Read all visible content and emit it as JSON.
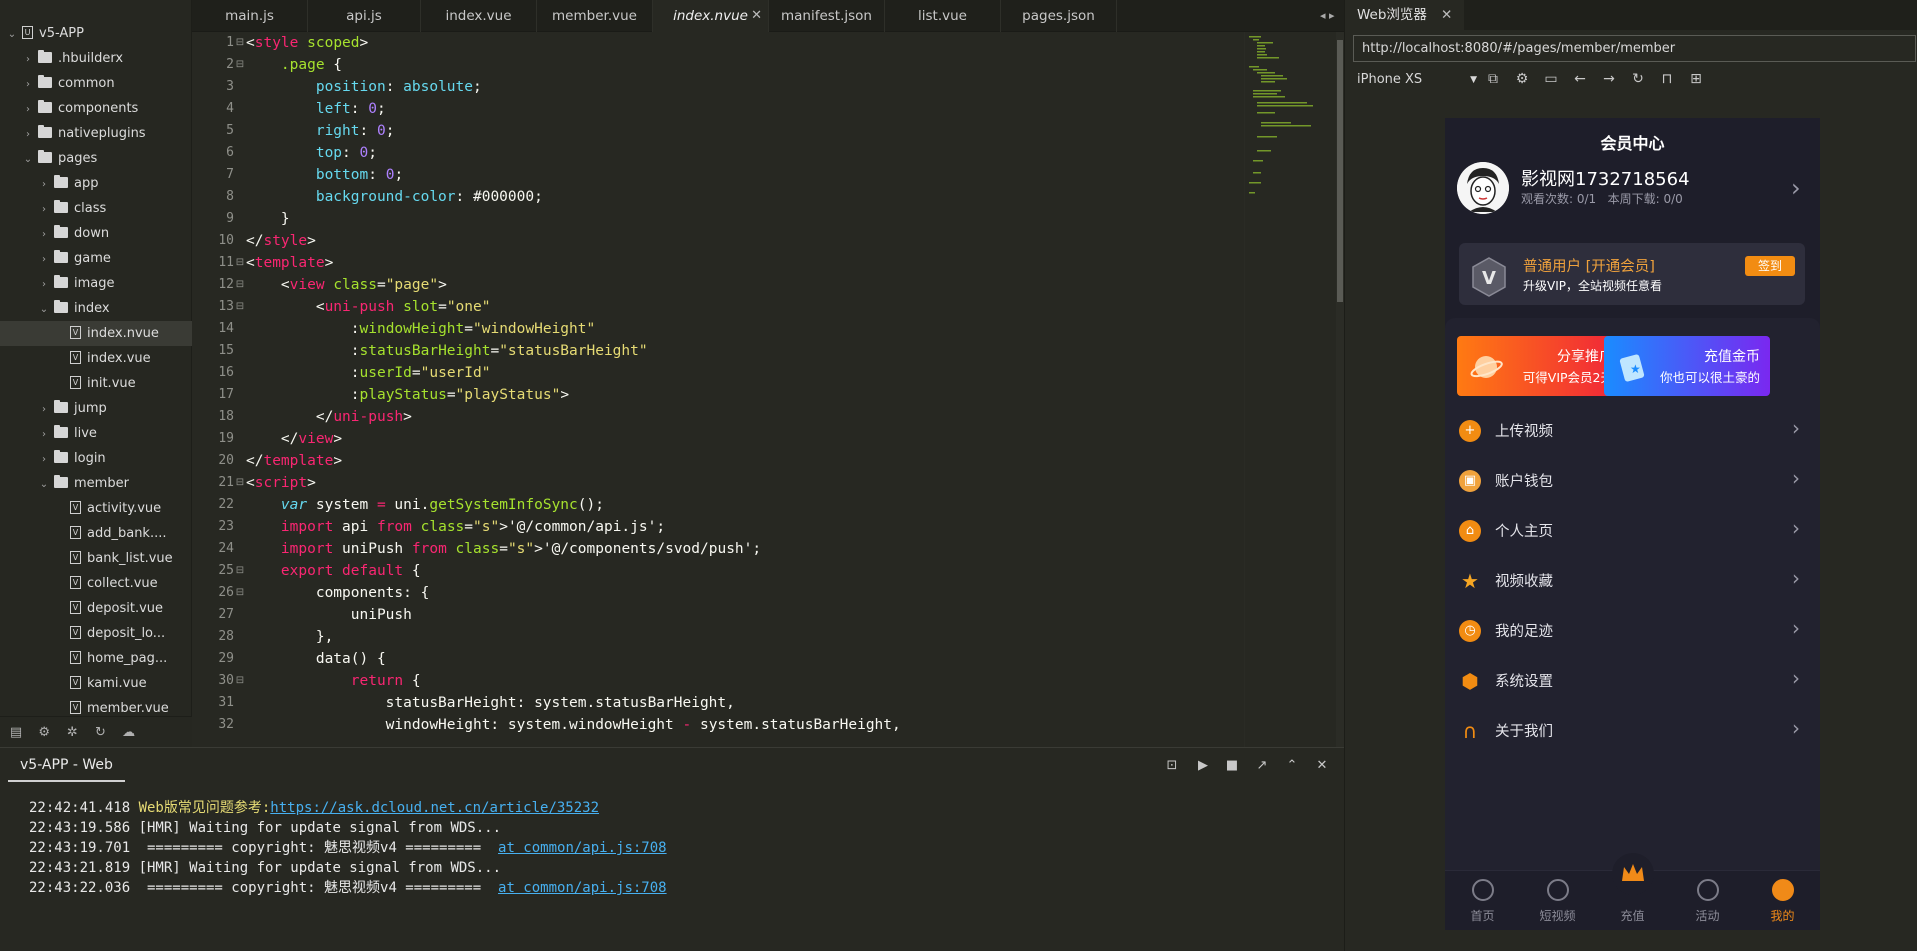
{
  "project": {
    "name": "v5-APP"
  },
  "tree": [
    {
      "label": "v5-APP",
      "kind": "project",
      "depth": 0,
      "open": true
    },
    {
      "label": ".hbuilderx",
      "kind": "folder",
      "depth": 1,
      "open": false
    },
    {
      "label": "common",
      "kind": "folder",
      "depth": 1,
      "open": false
    },
    {
      "label": "components",
      "kind": "folder",
      "depth": 1,
      "open": false
    },
    {
      "label": "nativeplugins",
      "kind": "folder",
      "depth": 1,
      "open": false
    },
    {
      "label": "pages",
      "kind": "folder",
      "depth": 1,
      "open": true
    },
    {
      "label": "app",
      "kind": "folder",
      "depth": 2,
      "open": false
    },
    {
      "label": "class",
      "kind": "folder",
      "depth": 2,
      "open": false
    },
    {
      "label": "down",
      "kind": "folder",
      "depth": 2,
      "open": false
    },
    {
      "label": "game",
      "kind": "folder",
      "depth": 2,
      "open": false
    },
    {
      "label": "image",
      "kind": "folder",
      "depth": 2,
      "open": false
    },
    {
      "label": "index",
      "kind": "folder",
      "depth": 2,
      "open": true
    },
    {
      "label": "index.nvue",
      "kind": "file",
      "depth": 3,
      "selected": true
    },
    {
      "label": "index.vue",
      "kind": "file",
      "depth": 3
    },
    {
      "label": "init.vue",
      "kind": "file",
      "depth": 3
    },
    {
      "label": "jump",
      "kind": "folder",
      "depth": 2,
      "open": false
    },
    {
      "label": "live",
      "kind": "folder",
      "depth": 2,
      "open": false
    },
    {
      "label": "login",
      "kind": "folder",
      "depth": 2,
      "open": false
    },
    {
      "label": "member",
      "kind": "folder",
      "depth": 2,
      "open": true
    },
    {
      "label": "activity.vue",
      "kind": "file",
      "depth": 3
    },
    {
      "label": "add_bank....",
      "kind": "file",
      "depth": 3
    },
    {
      "label": "bank_list.vue",
      "kind": "file",
      "depth": 3
    },
    {
      "label": "collect.vue",
      "kind": "file",
      "depth": 3
    },
    {
      "label": "deposit.vue",
      "kind": "file",
      "depth": 3
    },
    {
      "label": "deposit_lo...",
      "kind": "file",
      "depth": 3
    },
    {
      "label": "home_pag...",
      "kind": "file",
      "depth": 3
    },
    {
      "label": "kami.vue",
      "kind": "file",
      "depth": 3
    },
    {
      "label": "member.vue",
      "kind": "file",
      "depth": 3
    }
  ],
  "tabs": [
    {
      "label": "main.js",
      "active": false
    },
    {
      "label": "api.js",
      "active": false
    },
    {
      "label": "index.vue",
      "active": false
    },
    {
      "label": "member.vue",
      "active": false
    },
    {
      "label": "index.nvue",
      "active": true
    },
    {
      "label": "manifest.json",
      "active": false
    },
    {
      "label": "list.vue",
      "active": false
    },
    {
      "label": "pages.json",
      "active": false
    }
  ],
  "code": [
    "<style scoped>",
    "    .page {",
    "        position: absolute;",
    "        left: 0;",
    "        right: 0;",
    "        top: 0;",
    "        bottom: 0;",
    "        background-color: #000000;",
    "    }",
    "</style>",
    "<template>",
    "    <view class=\"page\">",
    "        <uni-push slot=\"one\"",
    "            :windowHeight=\"windowHeight\"",
    "            :statusBarHeight=\"statusBarHeight\"",
    "            :userId=\"userId\"",
    "            :playStatus=\"playStatus\">",
    "        </uni-push>",
    "    </view>",
    "</template>",
    "<script>",
    "    var system = uni.getSystemInfoSync();",
    "    import api from '@/common/api.js';",
    "    import uniPush from '@/components/svod/push';",
    "    export default {",
    "        components: {",
    "            uniPush",
    "        },",
    "        data() {",
    "            return {",
    "                statusBarHeight: system.statusBarHeight,",
    "                windowHeight: system.windowHeight - system.statusBarHeight,"
  ],
  "console": {
    "tab": "v5-APP - Web",
    "lines": [
      {
        "time": "22:42:41.418",
        "text": "Web版常见问题参考:",
        "link": "https://ask.dcloud.net.cn/article/35232",
        "warn": true
      },
      {
        "time": "22:43:19.586",
        "text": "[HMR] Waiting for update signal from WDS...",
        "link": ""
      },
      {
        "time": "22:43:19.701",
        "text": " ========= copyright: 魅思视频v4 =========  ",
        "link": "at common/api.js:708"
      },
      {
        "time": "22:43:21.819",
        "text": "[HMR] Waiting for update signal from WDS...",
        "link": ""
      },
      {
        "time": "22:43:22.036",
        "text": " ========= copyright: 魅思视频v4 =========  ",
        "link": "at common/api.js:708"
      }
    ]
  },
  "browser": {
    "tab": "Web浏览器",
    "url": "http://localhost:8080/#/pages/member/member",
    "device": "iPhone XS"
  },
  "app": {
    "title": "会员中心",
    "username": "影视网1732718564",
    "stats": "观看次数: 0/1   本周下载: 0/0",
    "vip_title": "普通用户 [开通会员]",
    "vip_sub": "升级VIP，全站视频任意看",
    "sign_label": "签到",
    "promo": [
      {
        "l1": "分享推广",
        "l2": "可得VIP会员2天"
      },
      {
        "l1": "充值金币",
        "l2": "你也可以很土豪的"
      }
    ],
    "menu": [
      {
        "label": "上传视频",
        "icon": "plus-circle-icon",
        "color": "#f28c12"
      },
      {
        "label": "账户钱包",
        "icon": "wallet-icon",
        "color": "#f0a23c"
      },
      {
        "label": "个人主页",
        "icon": "home-icon",
        "color": "#f28c12"
      },
      {
        "label": "视频收藏",
        "icon": "star-icon",
        "color": "#f6a623"
      },
      {
        "label": "我的足迹",
        "icon": "clock-icon",
        "color": "#f28c12"
      },
      {
        "label": "系统设置",
        "icon": "settings-icon",
        "color": "#f28c12"
      },
      {
        "label": "关于我们",
        "icon": "headphones-icon",
        "color": "#f28c12"
      }
    ],
    "tabbar": [
      {
        "label": "首页",
        "active": false
      },
      {
        "label": "短视频",
        "active": false
      },
      {
        "label": "充值",
        "active": false
      },
      {
        "label": "活动",
        "active": false
      },
      {
        "label": "我的",
        "active": true
      }
    ]
  },
  "colors": {
    "accent": "#f28c12",
    "editor_bg": "#272822",
    "app_bg": "#1e1e2a"
  }
}
